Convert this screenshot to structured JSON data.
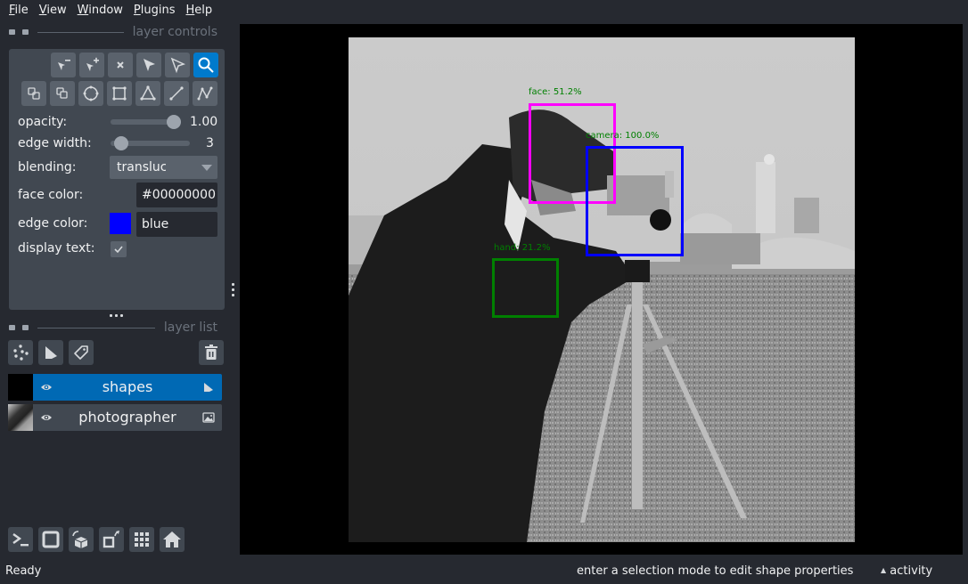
{
  "menubar": {
    "items": [
      {
        "label": "File",
        "mnemonic": "F",
        "rest": "ile"
      },
      {
        "label": "View",
        "mnemonic": "V",
        "rest": "iew"
      },
      {
        "label": "Window",
        "mnemonic": "W",
        "rest": "indow"
      },
      {
        "label": "Plugins",
        "mnemonic": "P",
        "rest": "lugins"
      },
      {
        "label": "Help",
        "mnemonic": "H",
        "rest": "elp"
      }
    ]
  },
  "layer_controls": {
    "title": "layer controls",
    "tools_row1": [
      {
        "name": "remove-vertex",
        "icon": "remove-vertex-icon"
      },
      {
        "name": "add-vertex",
        "icon": "add-vertex-icon"
      },
      {
        "name": "delete-shape",
        "icon": "delete-shape-icon"
      },
      {
        "name": "select",
        "icon": "select-arrow-icon"
      },
      {
        "name": "direct-select",
        "icon": "direct-select-icon"
      },
      {
        "name": "pan-zoom",
        "icon": "zoom-icon",
        "active": true
      }
    ],
    "tools_row2": [
      {
        "name": "move-back",
        "icon": "move-back-icon"
      },
      {
        "name": "move-front",
        "icon": "move-front-icon"
      },
      {
        "name": "ellipse",
        "icon": "ellipse-icon"
      },
      {
        "name": "rectangle",
        "icon": "rectangle-icon"
      },
      {
        "name": "polygon",
        "icon": "polygon-icon"
      },
      {
        "name": "line",
        "icon": "line-icon"
      },
      {
        "name": "path",
        "icon": "path-icon"
      }
    ],
    "opacity": {
      "label": "opacity:",
      "value": "1.00",
      "fraction": 1.0
    },
    "edge_width": {
      "label": "edge width:",
      "value": "3",
      "fraction": 0.08
    },
    "blending": {
      "label": "blending:",
      "value": "translucent"
    },
    "face_color": {
      "label": "face color:",
      "value": "#00000000"
    },
    "edge_color": {
      "label": "edge color:",
      "value": "blue",
      "swatch": "#0000ff"
    },
    "display_text": {
      "label": "display text:",
      "checked": true
    }
  },
  "layer_list": {
    "title": "layer list",
    "buttons": [
      "new-points-layer",
      "new-shapes-layer",
      "new-labels-layer",
      "delete-layer"
    ],
    "layers": [
      {
        "name": "shapes",
        "selected": true,
        "visible": true,
        "type": "shapes"
      },
      {
        "name": "photographer",
        "selected": false,
        "visible": true,
        "type": "image"
      }
    ]
  },
  "bottom_toolbar": [
    "console",
    "ndisplay-toggle",
    "roll-dims",
    "transpose-dims",
    "grid-mode",
    "home"
  ],
  "canvas": {
    "annotations": [
      {
        "label": "face: 51.2%",
        "category": "face",
        "score": 51.2,
        "edge_color": "#ff00ff"
      },
      {
        "label": "camera: 100.0%",
        "category": "camera",
        "score": 100.0,
        "edge_color": "#0000ff"
      },
      {
        "label": "hand: 21.2%",
        "category": "hand",
        "score": 21.2,
        "edge_color": "#008000"
      }
    ],
    "text_color": "#008000"
  },
  "status": {
    "ready": "Ready",
    "message": "enter a selection mode to edit shape properties",
    "activity": "activity"
  },
  "colors": {
    "accent": "#007acc",
    "selected_layer": "#0069b4"
  }
}
